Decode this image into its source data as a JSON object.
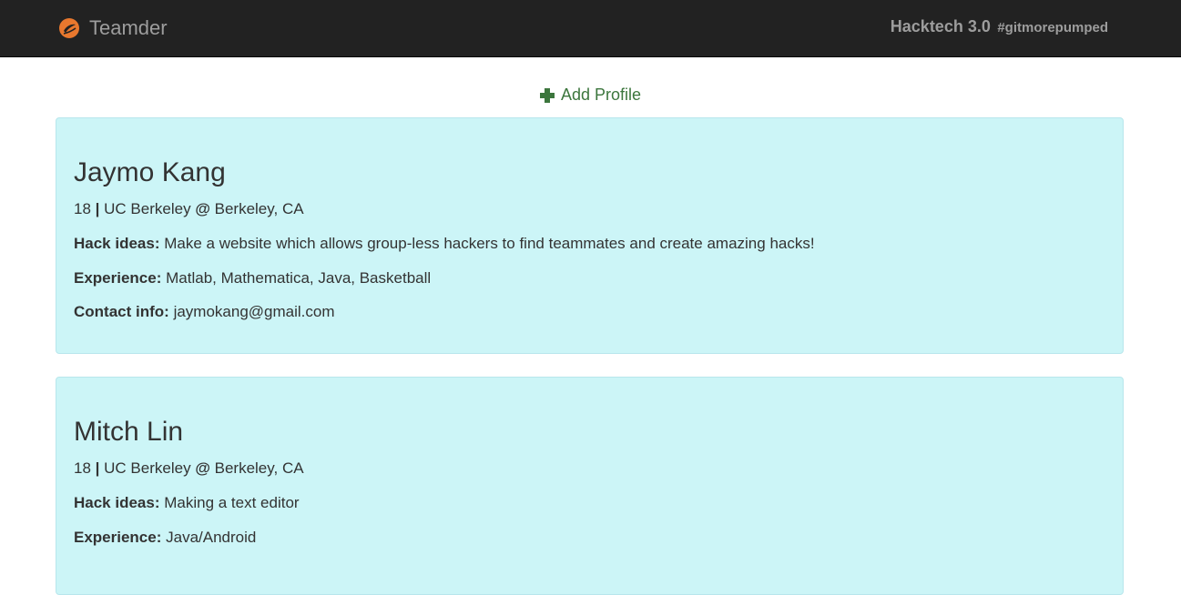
{
  "navbar": {
    "brand": "Teamder",
    "event": "Hacktech 3.0",
    "hashtag": "#gitmorepumped",
    "brand_color": "#e8782e"
  },
  "actions": {
    "add_profile": "Add Profile"
  },
  "labels": {
    "separator": "|",
    "at": "@",
    "hack_ideas": "Hack ideas:",
    "experience": "Experience:",
    "contact_info": "Contact info:"
  },
  "profiles": [
    {
      "name": "Jaymo Kang",
      "age": "18",
      "school": "UC Berkeley",
      "location": "Berkeley, CA",
      "hack_ideas": "Make a website which allows group-less hackers to find teammates and create amazing hacks!",
      "experience": "Matlab, Mathematica, Java, Basketball",
      "contact": "jaymokang@gmail.com"
    },
    {
      "name": "Mitch Lin",
      "age": "18",
      "school": "UC Berkeley",
      "location": "Berkeley, CA",
      "hack_ideas": "Making a text editor",
      "experience": "Java/Android"
    }
  ]
}
